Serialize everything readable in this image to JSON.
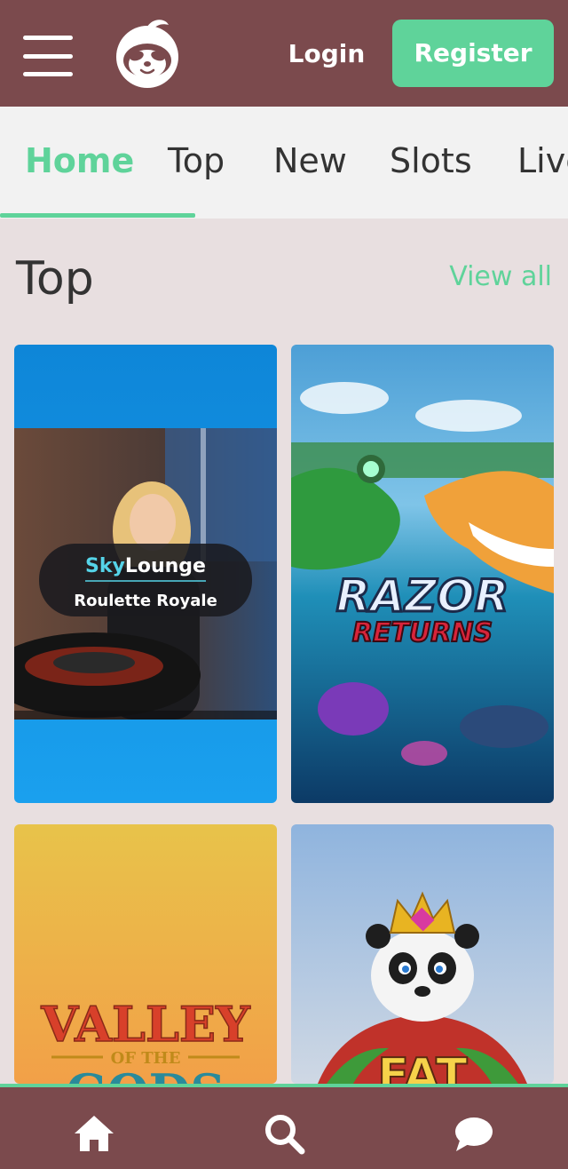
{
  "header": {
    "login_label": "Login",
    "register_label": "Register",
    "menu_icon": "hamburger-menu-icon",
    "logo_icon": "sloth-logo-icon"
  },
  "tabs": [
    {
      "label": "Home",
      "active": true
    },
    {
      "label": "Top",
      "active": false
    },
    {
      "label": "New",
      "active": false
    },
    {
      "label": "Slots",
      "active": false
    },
    {
      "label": "Live",
      "active": false
    }
  ],
  "section": {
    "title": "Top",
    "view_all": "View all"
  },
  "games": [
    {
      "brand_prefix": "Sky",
      "brand_suffix": "Lounge",
      "name": "Roulette Royale"
    },
    {
      "title_line1": "RAZOR",
      "title_line2": "RETURNS"
    },
    {
      "title_line1": "VALLEY",
      "title_line2": "OF THE",
      "title_line3": "GODS"
    },
    {
      "title_line1": "FAT"
    }
  ],
  "bottom_nav": {
    "items": [
      "home-icon",
      "search-icon",
      "chat-icon"
    ]
  },
  "colors": {
    "brand": "#7b4a4d",
    "accent": "#5fd39a",
    "background": "#e8dfe0"
  }
}
